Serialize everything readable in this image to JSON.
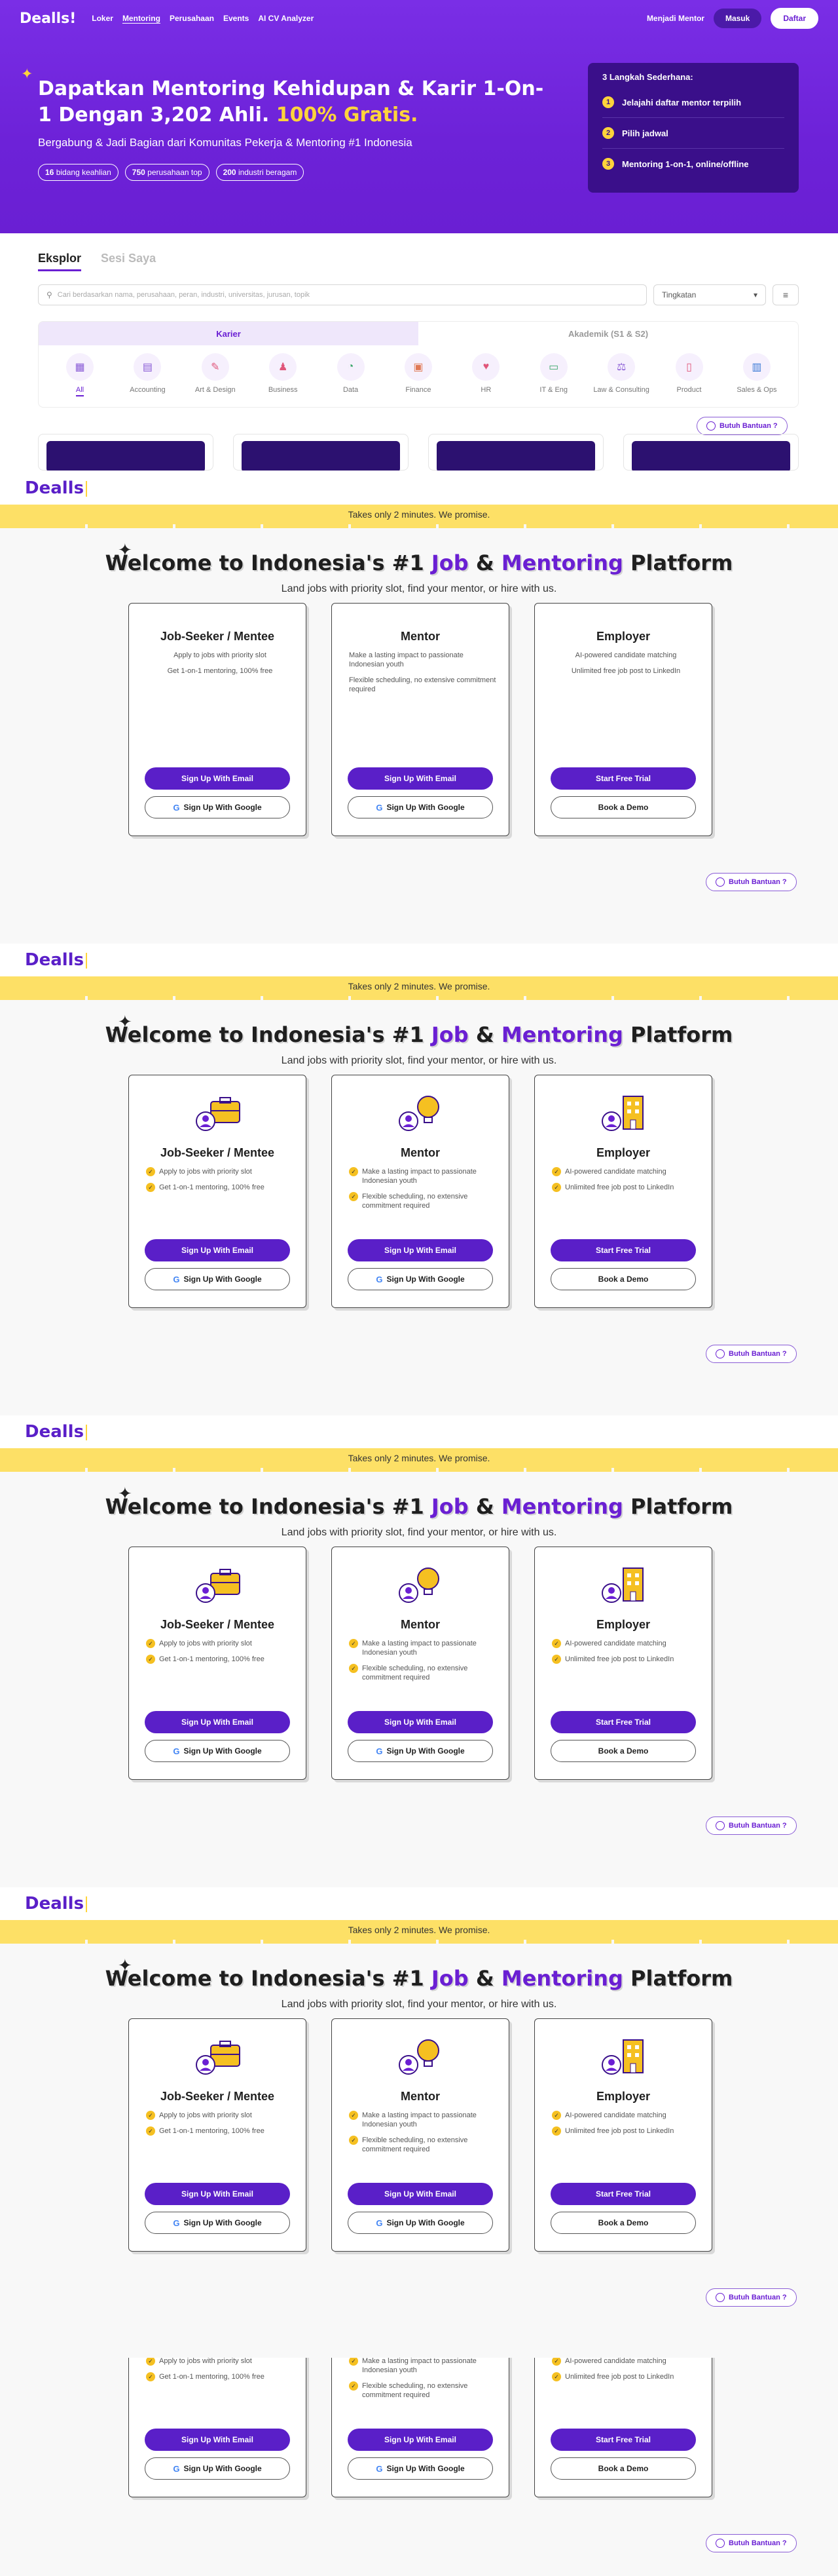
{
  "nav": {
    "logo": "Dealls!",
    "links": [
      "Loker",
      "Mentoring",
      "Perusahaan",
      "Events",
      "AI CV Analyzer"
    ],
    "mentor": "Menjadi Mentor",
    "masuk": "Masuk",
    "daftar": "Daftar"
  },
  "hero": {
    "title_main": "Dapatkan Mentoring Kehidupan & Karir 1-On-1 Dengan 3,202 Ahli.",
    "title_highlight": "100% Gratis.",
    "subtitle": "Bergabung & Jadi Bagian dari Komunitas Pekerja & Mentoring #1 Indonesia",
    "badges": [
      {
        "num": "16",
        "text": "bidang keahlian"
      },
      {
        "num": "750",
        "text": "perusahaan top"
      },
      {
        "num": "200",
        "text": "industri beragam"
      }
    ],
    "steps_title": "3 Langkah Sederhana:",
    "steps": [
      {
        "n": "1",
        "text": "Jelajahi daftar mentor terpilih"
      },
      {
        "n": "2",
        "text": "Pilih jadwal"
      },
      {
        "n": "3",
        "text": "Mentoring 1-on-1, online/offline"
      }
    ]
  },
  "explore": {
    "tabs": [
      "Eksplor",
      "Sesi Saya"
    ],
    "search_placeholder": "Cari berdasarkan nama, perusahaan, peran, industri, universitas, jurusan, topik",
    "select_label": "Tingkatan",
    "cat_tabs": [
      "Karier",
      "Akademik (S1 & S2)"
    ],
    "categories": [
      "All",
      "Accounting",
      "Art & Design",
      "Business",
      "Data",
      "Finance",
      "HR",
      "IT & Eng",
      "Law & Consulting",
      "Product",
      "Sales & Ops"
    ]
  },
  "help_label": "Butuh Bantuan ?",
  "signup": {
    "logo": "Dealls",
    "banner": "Takes only 2 minutes. We promise.",
    "welcome_a": "Welcome to Indonesia's #1",
    "welcome_job": "Job",
    "welcome_amp": "&",
    "welcome_mentoring": "Mentoring",
    "welcome_b": "Platform",
    "tagline": "Land jobs with priority slot, find your mentor, or hire with us.",
    "cards": [
      {
        "title": "Job-Seeker / Mentee",
        "icon": "briefcase-person-icon",
        "points": [
          "Apply to jobs with priority slot",
          "Get 1-on-1 mentoring, 100% free"
        ],
        "primary": "Sign Up With Email",
        "secondary": "Sign Up With Google"
      },
      {
        "title": "Mentor",
        "icon": "lightbulb-person-icon",
        "points": [
          "Make a lasting impact to passionate Indonesian youth",
          "Flexible scheduling, no extensive commitment required"
        ],
        "primary": "Sign Up With Email",
        "secondary": "Sign Up With Google"
      },
      {
        "title": "Employer",
        "icon": "building-person-icon",
        "points": [
          "AI-powered candidate matching",
          "Unlimited free job post to LinkedIn"
        ],
        "primary": "Start Free Trial",
        "secondary": "Book a Demo"
      }
    ]
  },
  "colors": {
    "brand": "#6a1fd3",
    "accent": "#ffd43b",
    "banner": "#fde066"
  }
}
